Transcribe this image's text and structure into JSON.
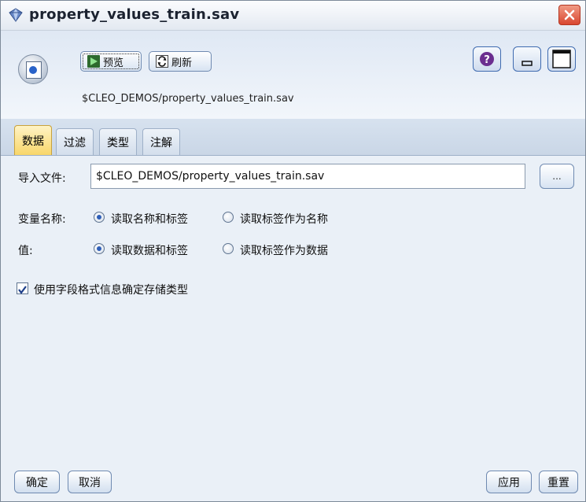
{
  "window": {
    "title": "property_values_train.sav"
  },
  "toolbar": {
    "preview_label": "预览",
    "refresh_label": "刷新",
    "file_path_label": "$CLEO_DEMOS/property_values_train.sav"
  },
  "tabs": [
    {
      "label": "数据",
      "active": true
    },
    {
      "label": "过滤",
      "active": false
    },
    {
      "label": "类型",
      "active": false
    },
    {
      "label": "注解",
      "active": false
    }
  ],
  "form": {
    "import_file_label": "导入文件:",
    "import_file_value": "$CLEO_DEMOS/property_values_train.sav",
    "browse_label": "...",
    "variable_names_label": "变量名称:",
    "variable_names_options": [
      {
        "label": "读取名称和标签",
        "selected": true
      },
      {
        "label": "读取标签作为名称",
        "selected": false
      }
    ],
    "values_label": "值:",
    "values_options": [
      {
        "label": "读取数据和标签",
        "selected": true
      },
      {
        "label": "读取标签作为数据",
        "selected": false
      }
    ],
    "use_format_checkbox_label": "使用字段格式信息确定存储类型",
    "use_format_checked": true
  },
  "buttons": {
    "ok": "确定",
    "cancel": "取消",
    "apply": "应用",
    "reset": "重置"
  },
  "colors": {
    "active_tab": "#f8d66a",
    "close_button": "#d9462f",
    "panel_background": "#eaf0f7"
  }
}
